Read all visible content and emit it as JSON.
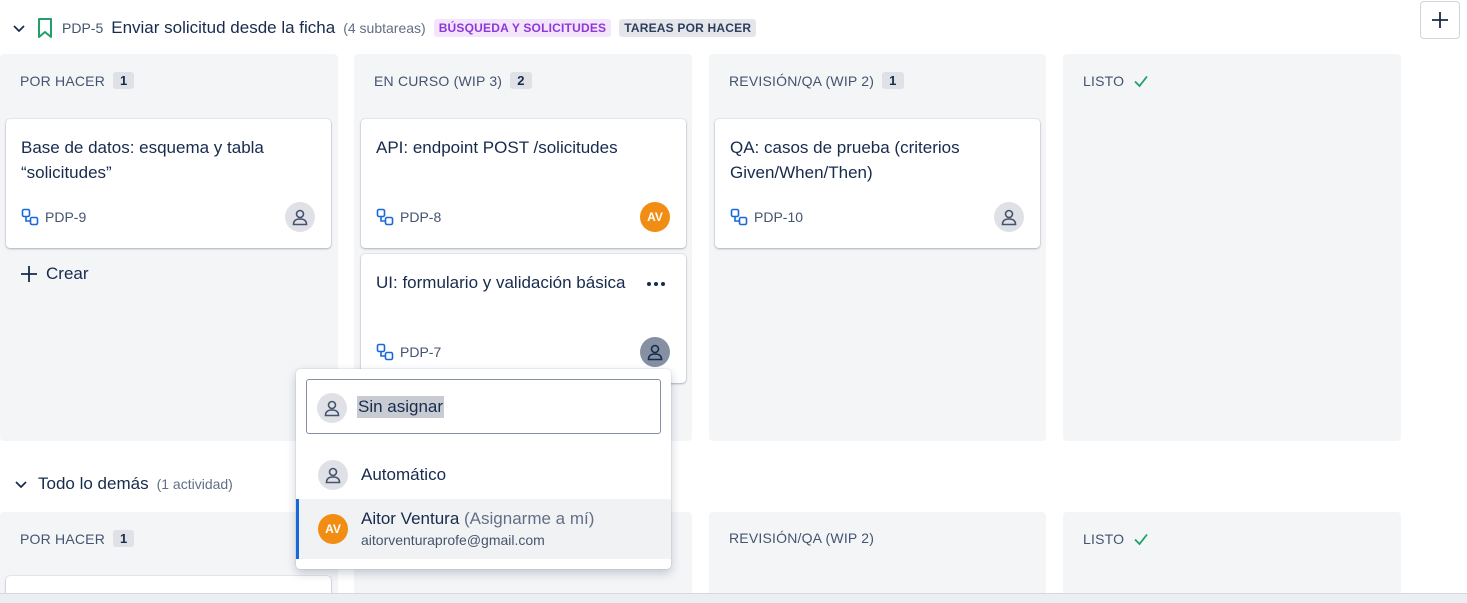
{
  "story": {
    "key": "PDP-5",
    "title": "Enviar solicitud desde la ficha",
    "subtasks": "(4 subtareas)",
    "labels": [
      "BÚSQUEDA Y SOLICITUDES",
      "TAREAS POR HACER"
    ]
  },
  "columns": [
    {
      "title": "POR HACER",
      "count": "1"
    },
    {
      "title": "EN CURSO (WIP 3)",
      "count": "2"
    },
    {
      "title": "REVISIÓN/QA (WIP 2)",
      "count": "1"
    },
    {
      "title": "LISTO"
    }
  ],
  "cards": [
    {
      "title": "Base de datos: esquema y tabla “solicitudes”",
      "key": "PDP-9",
      "assignee": "unassigned"
    },
    {
      "title": "API: endpoint POST /solicitudes",
      "key": "PDP-8",
      "assignee": "AV"
    },
    {
      "title": "UI: formulario y validación básica",
      "key": "PDP-7",
      "assignee": "unassigned"
    },
    {
      "title": "QA: casos de prueba (criterios Given/When/Then)",
      "key": "PDP-10",
      "assignee": "unassigned"
    }
  ],
  "create_label": "Crear",
  "other": {
    "title": "Todo lo demás",
    "count": "(1 actividad)",
    "columns": [
      {
        "title": "POR HACER",
        "count": "1"
      },
      {
        "title": "REVISIÓN/QA (WIP 2)"
      },
      {
        "title": "LISTO"
      }
    ]
  },
  "assignee_dropdown": {
    "search_value": "Sin asignar",
    "options": [
      {
        "label": "Automático"
      },
      {
        "label": "Aitor Ventura",
        "hint": "(Asignarme a mí)",
        "email": "aitorventuraprofe@gmail.com",
        "initials": "AV"
      }
    ]
  },
  "colors": {
    "accent": "#1868db",
    "avatar_orange": "#f18d13",
    "done_check": "#22a06b",
    "bookmark": "#22a06b"
  },
  "icons": [
    "chevron-down-icon",
    "bookmark-icon",
    "plus-icon",
    "check-icon",
    "subtask-icon",
    "person-icon",
    "more-icon"
  ]
}
